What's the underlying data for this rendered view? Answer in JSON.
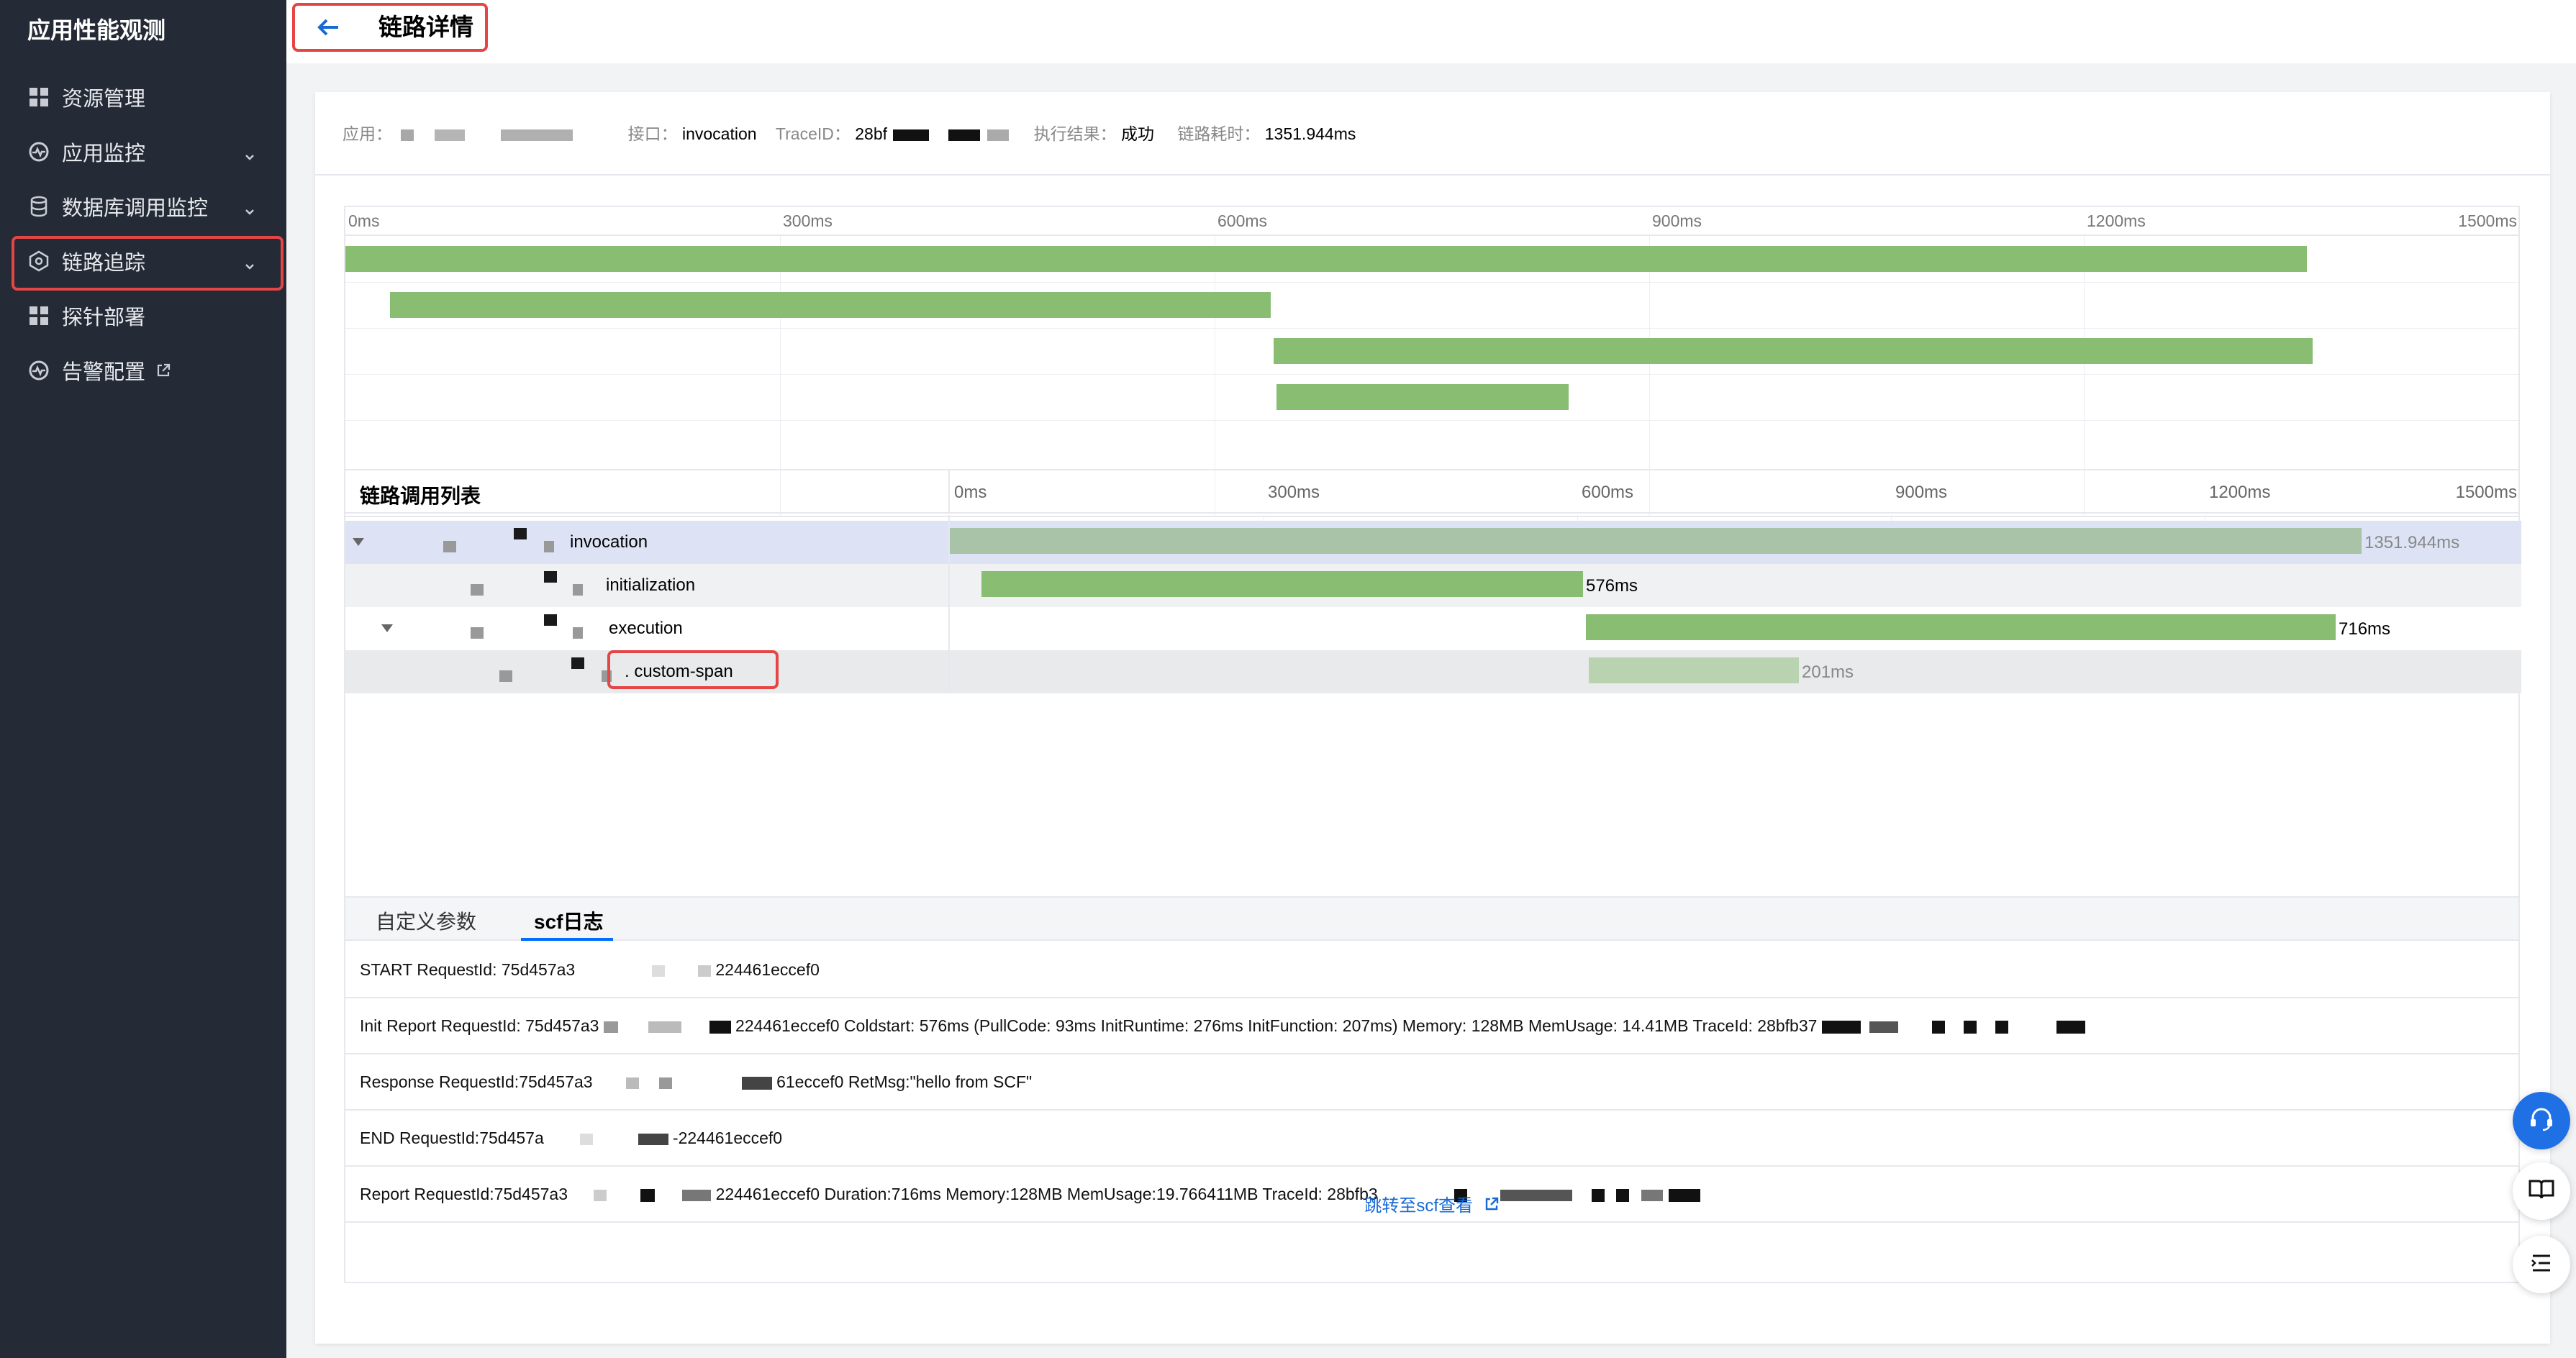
{
  "sidebar": {
    "brand": "应用性能观测",
    "items": [
      {
        "label": "资源管理"
      },
      {
        "label": "应用监控"
      },
      {
        "label": "数据库调用监控"
      },
      {
        "label": "链路追踪"
      },
      {
        "label": "探针部署"
      },
      {
        "label": "告警配置"
      }
    ]
  },
  "header": {
    "title": "链路详情"
  },
  "info": {
    "app_label": "应用：",
    "api_label": "接口：",
    "api_value": "invocation",
    "trace_label": "TraceID：",
    "trace_value": "28bf",
    "result_label": "执行结果：",
    "result_value": "成功",
    "cost_label": "链路耗时：",
    "cost_value": "1351.944ms"
  },
  "timeline": {
    "ticks": [
      "0ms",
      "300ms",
      "600ms",
      "900ms",
      "1200ms",
      "1500ms"
    ]
  },
  "list": {
    "title": "链路调用列表",
    "ticks": [
      "0ms",
      "300ms",
      "600ms",
      "900ms",
      "1200ms",
      "1500ms"
    ],
    "spans": [
      {
        "name": "invocation",
        "duration": "1351.944ms"
      },
      {
        "name": "initialization",
        "duration": "576ms"
      },
      {
        "name": "execution",
        "duration": "716ms"
      },
      {
        "name": ". custom-span",
        "duration": "201ms"
      }
    ]
  },
  "tabs": [
    {
      "label": "自定义参数"
    },
    {
      "label": "scf日志"
    }
  ],
  "logs": {
    "l1_a": "START RequestId: 75d457a3",
    "l1_b": "224461eccef0",
    "l2_a": "Init Report RequestId: 75d457a3",
    "l2_b": "224461eccef0 Coldstart: 576ms (PullCode: 93ms InitRuntime: 276ms InitFunction: 207ms) Memory: 128MB MemUsage: 14.41MB TraceId: 28bfb37",
    "l3_a": "Response RequestId:75d457a3",
    "l3_b": "61eccef0 RetMsg:\"hello from SCF\"",
    "l4_a": "END RequestId:75d457a",
    "l4_b": "-224461eccef0",
    "l5_a": "Report RequestId:75d457a3",
    "l5_b": "224461eccef0 Duration:716ms Memory:128MB MemUsage:19.766411MB TraceId: 28bfb3"
  },
  "jump_link": "跳转至scf查看"
}
